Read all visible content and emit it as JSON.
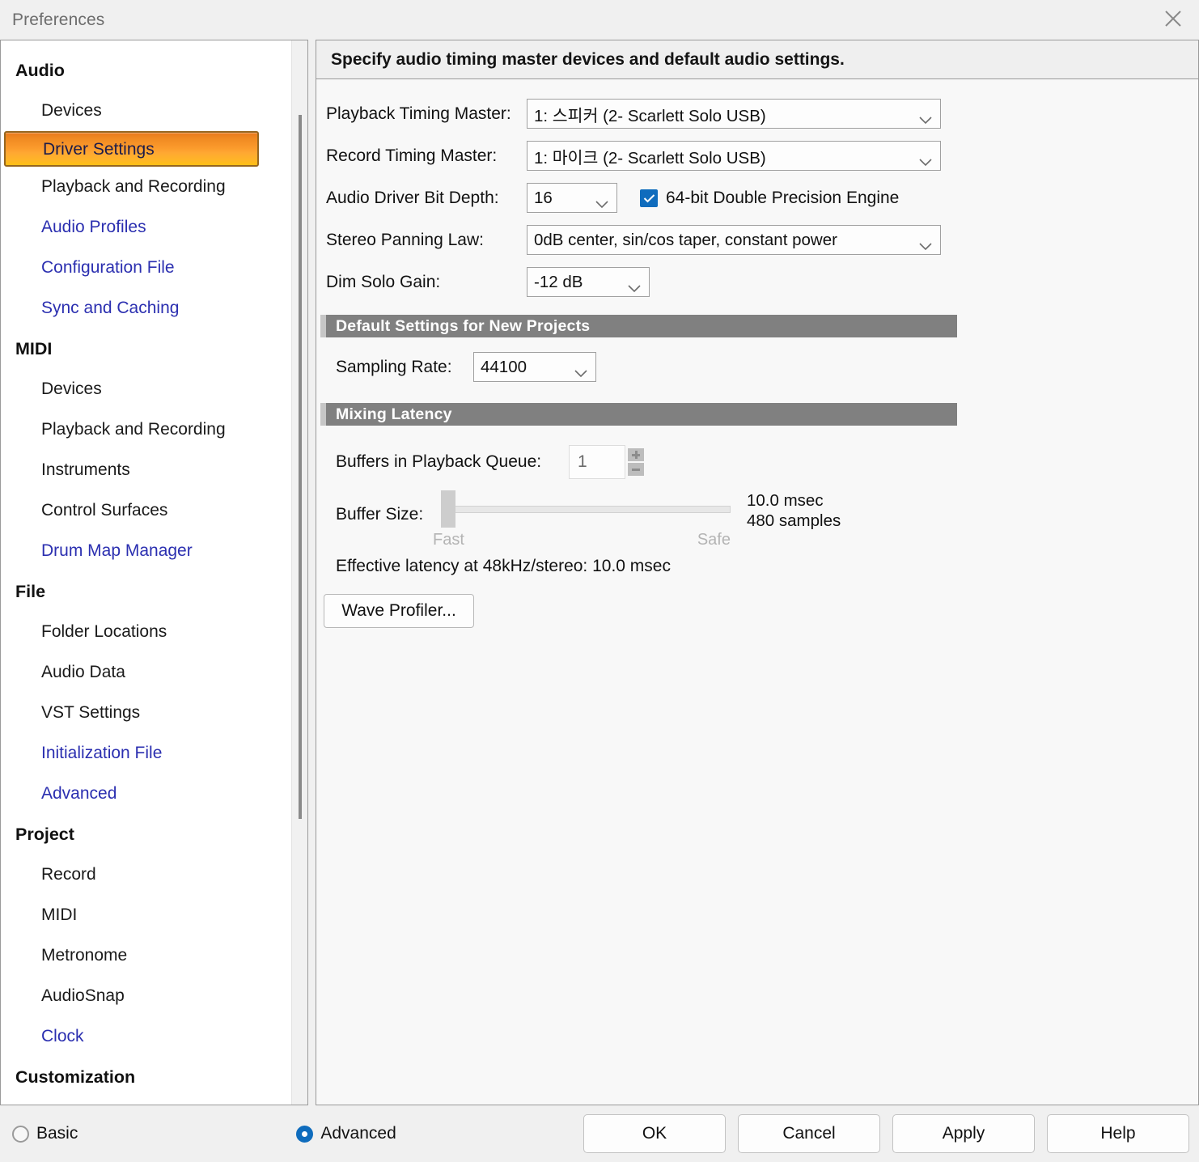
{
  "window": {
    "title": "Preferences",
    "close_icon": "close-icon"
  },
  "sidebar": {
    "groups": [
      {
        "label": "Audio",
        "items": [
          {
            "label": "Devices",
            "style": "plain",
            "selected": false
          },
          {
            "label": "Driver Settings",
            "style": "plain",
            "selected": true
          },
          {
            "label": "Playback and Recording",
            "style": "plain",
            "selected": false
          },
          {
            "label": "Audio Profiles",
            "style": "link",
            "selected": false
          },
          {
            "label": "Configuration File",
            "style": "link",
            "selected": false
          },
          {
            "label": "Sync and Caching",
            "style": "link",
            "selected": false
          }
        ]
      },
      {
        "label": "MIDI",
        "items": [
          {
            "label": "Devices",
            "style": "plain",
            "selected": false
          },
          {
            "label": "Playback and Recording",
            "style": "plain",
            "selected": false
          },
          {
            "label": "Instruments",
            "style": "plain",
            "selected": false
          },
          {
            "label": "Control Surfaces",
            "style": "plain",
            "selected": false
          },
          {
            "label": "Drum Map Manager",
            "style": "link",
            "selected": false
          }
        ]
      },
      {
        "label": "File",
        "items": [
          {
            "label": "Folder Locations",
            "style": "plain",
            "selected": false
          },
          {
            "label": "Audio Data",
            "style": "plain",
            "selected": false
          },
          {
            "label": "VST Settings",
            "style": "plain",
            "selected": false
          },
          {
            "label": "Initialization File",
            "style": "link",
            "selected": false
          },
          {
            "label": "Advanced",
            "style": "link",
            "selected": false
          }
        ]
      },
      {
        "label": "Project",
        "items": [
          {
            "label": "Record",
            "style": "plain",
            "selected": false
          },
          {
            "label": "MIDI",
            "style": "plain",
            "selected": false
          },
          {
            "label": "Metronome",
            "style": "plain",
            "selected": false
          },
          {
            "label": "AudioSnap",
            "style": "plain",
            "selected": false
          },
          {
            "label": "Clock",
            "style": "link",
            "selected": false
          }
        ]
      },
      {
        "label": "Customization",
        "items": []
      }
    ]
  },
  "main": {
    "header": "Specify audio timing master devices and default audio settings.",
    "fields": {
      "playback_timing_master": {
        "label": "Playback Timing Master:",
        "value": "1: 스피커 (2- Scarlett Solo USB)"
      },
      "record_timing_master": {
        "label": "Record Timing Master:",
        "value": "1: 마이크 (2- Scarlett Solo USB)"
      },
      "audio_driver_bit_depth": {
        "label": "Audio Driver Bit Depth:",
        "value": "16"
      },
      "double_precision": {
        "label": "64-bit Double Precision Engine",
        "checked": true
      },
      "stereo_panning_law": {
        "label": "Stereo Panning Law:",
        "value": "0dB center, sin/cos taper, constant power"
      },
      "dim_solo_gain": {
        "label": "Dim Solo Gain:",
        "value": "-12 dB"
      }
    },
    "section_defaults": {
      "title": "Default Settings for New Projects",
      "sampling_rate": {
        "label": "Sampling Rate:",
        "value": "44100"
      }
    },
    "section_latency": {
      "title": "Mixing Latency",
      "buffers_in_queue": {
        "label": "Buffers in Playback Queue:",
        "value": "1",
        "increment_icon": "plus-icon",
        "decrement_icon": "minus-icon"
      },
      "buffer_size": {
        "label": "Buffer Size:",
        "min_label": "Fast",
        "max_label": "Safe",
        "msec": "10.0 msec",
        "samples": "480 samples",
        "position_percent": 0
      },
      "effective_latency": "Effective latency at 48kHz/stereo:  10.0 msec",
      "wave_profiler_button": "Wave Profiler..."
    }
  },
  "footer": {
    "mode_basic": {
      "label": "Basic",
      "selected": false
    },
    "mode_advanced": {
      "label": "Advanced",
      "selected": true
    },
    "buttons": [
      {
        "label": "OK"
      },
      {
        "label": "Cancel"
      },
      {
        "label": "Apply"
      },
      {
        "label": "Help"
      }
    ]
  },
  "colors": {
    "accent_blue": "#0f6cbd",
    "selection_orange": "#ffa832",
    "link_blue": "#2b2fb0",
    "section_gray": "#808080"
  }
}
